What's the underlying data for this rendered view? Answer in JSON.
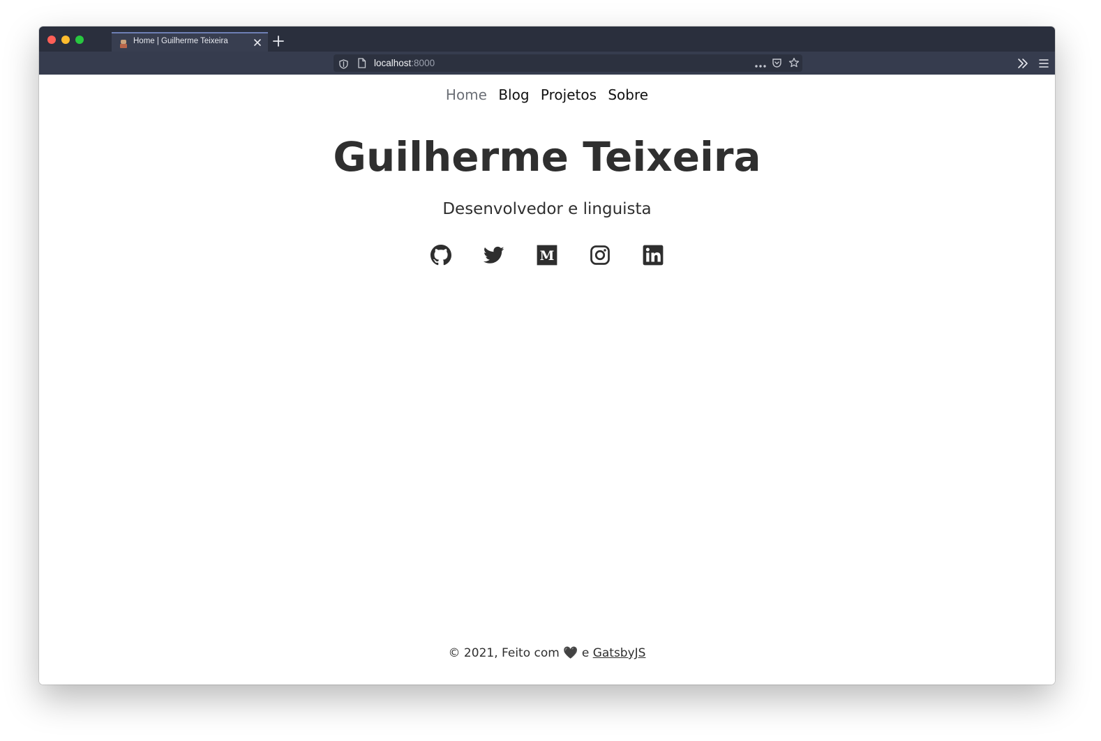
{
  "browser": {
    "tab_title": "Home | Guilherme Teixeira",
    "url_host": "localhost",
    "url_port": ":8000"
  },
  "site_nav": {
    "items": [
      {
        "label": "Home",
        "active": true
      },
      {
        "label": "Blog",
        "active": false
      },
      {
        "label": "Projetos",
        "active": false
      },
      {
        "label": "Sobre",
        "active": false
      }
    ]
  },
  "hero": {
    "title": "Guilherme Teixeira",
    "subtitle": "Desenvolvedor e linguista"
  },
  "socials": [
    {
      "name": "github-icon"
    },
    {
      "name": "twitter-icon"
    },
    {
      "name": "medium-icon"
    },
    {
      "name": "instagram-icon"
    },
    {
      "name": "linkedin-icon"
    }
  ],
  "footer": {
    "prefix": "© 2021, Feito com",
    "heart": "🖤",
    "conj": "e",
    "link_label": "GatsbyJS"
  },
  "colors": {
    "tabstrip": "#2a2f3d",
    "toolbar": "#363c4e",
    "text": "#2f2f2f",
    "nav_active": "#6b6f76"
  }
}
